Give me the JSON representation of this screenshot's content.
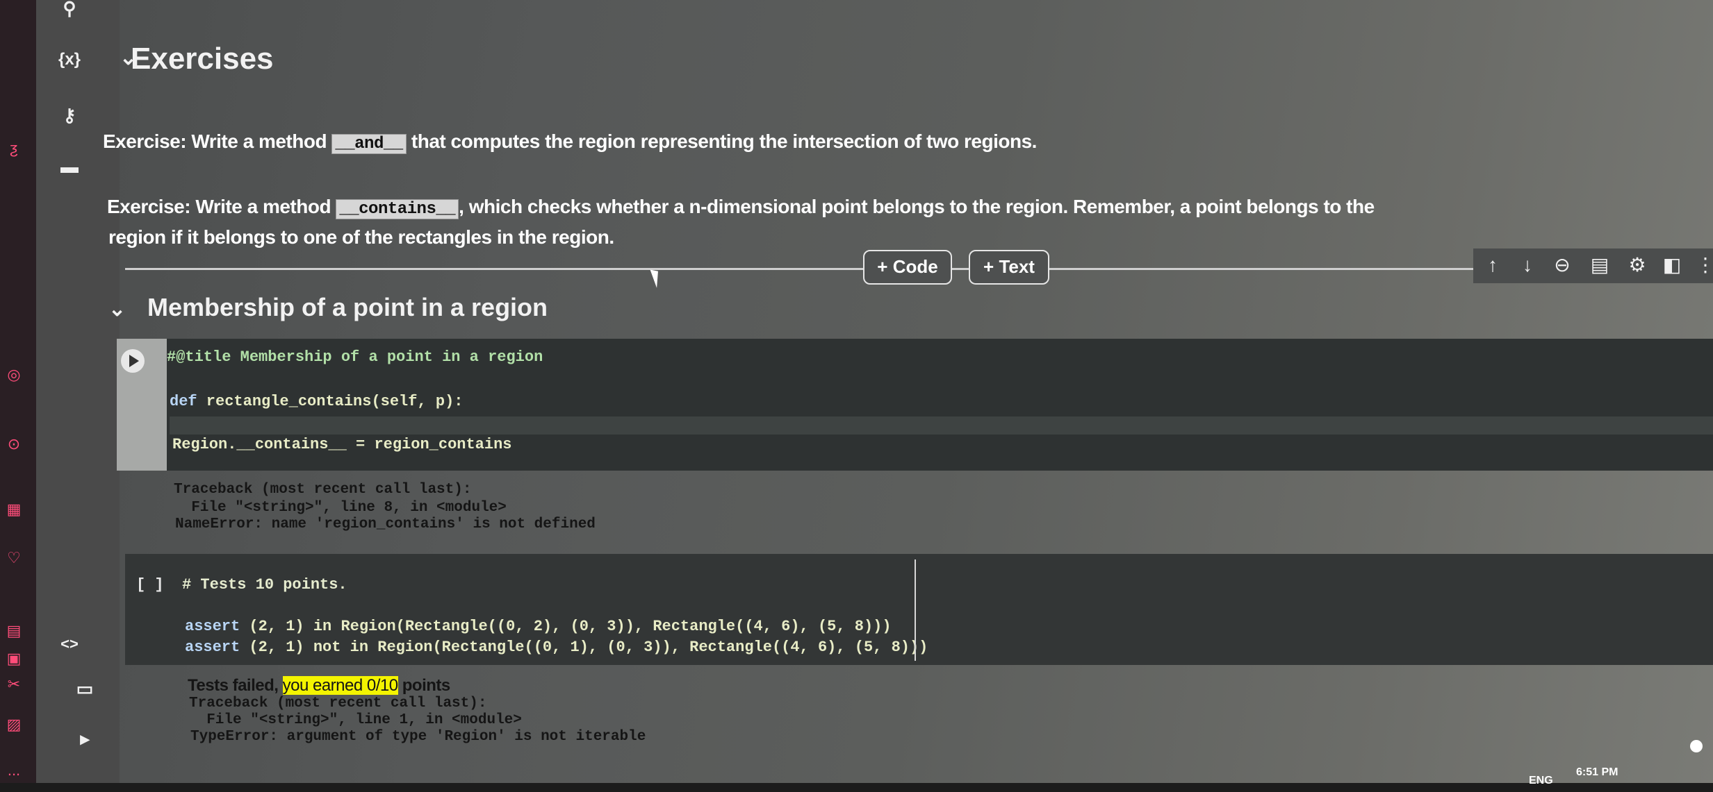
{
  "sidebar": {
    "icons": [
      "search-icon",
      "variables-icon",
      "key-icon",
      "folder-icon"
    ],
    "variables_label": "{x}",
    "bottom_icons": [
      "code-snippets-icon",
      "command-palette-icon",
      "terminal-icon"
    ],
    "code_snippets_label": "<>"
  },
  "os_strip": {
    "icons": [
      "app-icon",
      "instagram-icon",
      "play-icon",
      "grid-icon",
      "heart-icon",
      "layout-icon",
      "chip-icon",
      "tools-icon",
      "image-icon",
      "more-icon"
    ],
    "more_label": "..."
  },
  "exercises_section": {
    "title": "Exercises",
    "exercise1": {
      "prefix": "Exercise: Write a method ",
      "code": "__and__",
      "suffix": " that computes the region representing the intersection of two regions."
    },
    "exercise2": {
      "prefix": "Exercise: Write a method ",
      "code": "__contains__",
      "suffix": ", which checks whether a n-dimensional point belongs to the region. Remember, a point belongs to the",
      "line2": "region if it belongs to one of the rectangles in the region."
    }
  },
  "add_cell": {
    "code_label": "+ Code",
    "text_label": "+ Text"
  },
  "cell_toolbar": {
    "icons": [
      "move-up-icon",
      "move-down-icon",
      "link-icon",
      "comment-icon",
      "settings-icon",
      "mirror-icon",
      "more-icon"
    ]
  },
  "membership_section": {
    "title": "Membership of a point in a region",
    "code": {
      "line1": "#@title Membership of a point in a region",
      "line2_kw": "def",
      "line2_rest": " rectangle_contains(self, p):",
      "line3": "Region.__contains__ = region_contains"
    },
    "output": [
      "Traceback (most recent call last):",
      "  File \"<string>\", line 8, in <module>",
      "NameError: name 'region_contains' is not defined"
    ]
  },
  "tests_cell": {
    "prompt": "[ ]",
    "comment": "# Tests 10 points.",
    "line1_kw": "assert",
    "line1_rest": " (2, 1) in Region(Rectangle((0, 2), (0, 3)), Rectangle((4, 6), (5, 8)))",
    "line2_kw": "assert",
    "line2_rest": " (2, 1) not in Region(Rectangle((0, 1), (0, 3)), Rectangle((4, 6), (5, 8)))",
    "output": {
      "tests_failed": "Tests failed,",
      "earned": "you earned 0/10",
      "points": " points",
      "traceback": [
        "Traceback (most recent call last):",
        "  File \"<string>\", line 1, in <module>",
        "TypeError: argument of type 'Region' is not iterable"
      ]
    }
  },
  "taskbar": {
    "language": "ENG",
    "time": "6:51 PM"
  },
  "colors": {
    "code_bg": "#2e3232",
    "gutter": "#a7a9a7",
    "highlight": "#f4f400",
    "background": "#565858"
  }
}
